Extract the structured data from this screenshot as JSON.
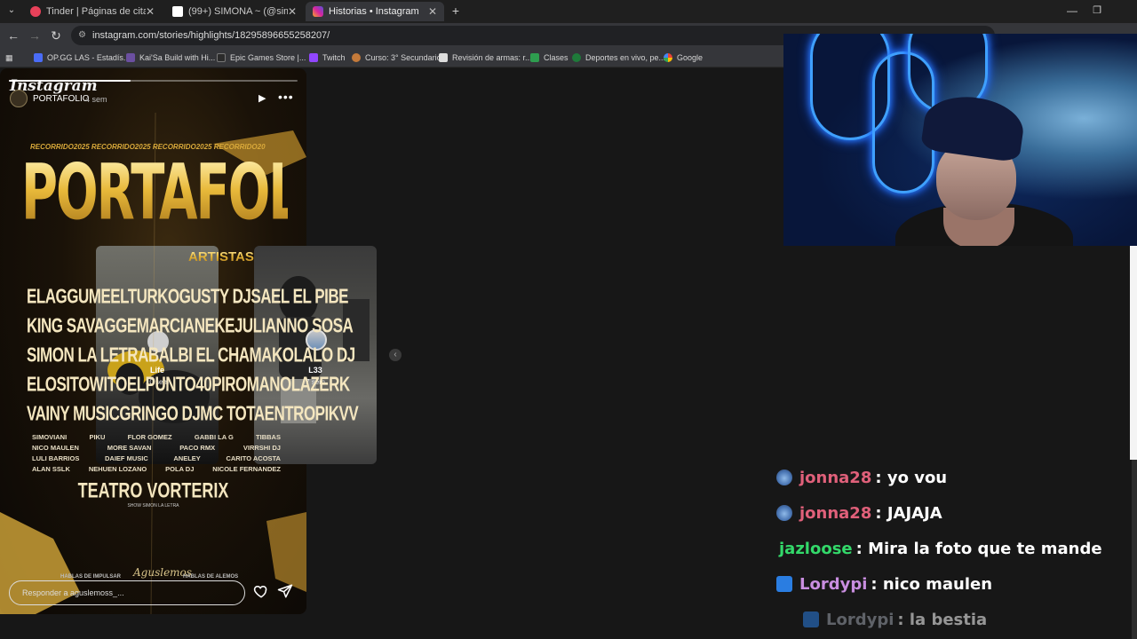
{
  "browser": {
    "tabs": [
      {
        "label": "Tinder | Páginas de citas",
        "icon_color": "#e8415a",
        "active": false
      },
      {
        "label": "(99+) SIMONA ~ (@simovianii)",
        "icon_color": "#ffffff",
        "active": false
      },
      {
        "label": "Historias • Instagram",
        "icon_color": "#d6249f",
        "active": true
      }
    ],
    "new_tab_label": "+",
    "url": "instagram.com/stories/highlights/18295896655258207/",
    "bookmarks": [
      {
        "label": "OP.GG LAS - Estadís...",
        "icon_color": "#4a6cf7"
      },
      {
        "label": "Kai'Sa Build with Hi...",
        "icon_color": "#6b4fa0"
      },
      {
        "label": "Epic Games Store |...",
        "icon_color": "#2b2b2b"
      },
      {
        "label": "Twitch",
        "icon_color": "#9146ff"
      },
      {
        "label": "Curso: 3° Secundario",
        "icon_color": "#c47a3a"
      },
      {
        "label": "Revisión de armas: r...",
        "icon_color": "#dddddd"
      },
      {
        "label": "Clases",
        "icon_color": "#2e9d4f"
      },
      {
        "label": "Deportes en vivo, pe...",
        "icon_color": "#1f7a3a"
      },
      {
        "label": "Google",
        "icon_color": "#ffffff"
      }
    ]
  },
  "instagram": {
    "logo": "Instagram",
    "previews": [
      {
        "title": "Life",
        "time": "10 sem"
      },
      {
        "title": "L33",
        "time": "7 sem"
      }
    ],
    "story": {
      "progress": 0.42,
      "username": "PORTAFOLIO",
      "time": "4 sem",
      "reply_placeholder": "Responder a aguslemoss_...",
      "poster": {
        "recorrido_line": "RECORRIDO2025 RECORRIDO2025 RECORRIDO2025 RECORRIDO20",
        "title": "PORTAFOLIO",
        "subtitle": "ARTISTAS",
        "artist_rows": [
          [
            "ELAGGUME",
            "ELTURKO",
            "GUSTY DJ",
            "SAEL EL PIBE"
          ],
          [
            "KING SAVAGGE",
            "MARCIANEKE",
            "JULIANNO SOSA"
          ],
          [
            "SIMON LA LETRA",
            "BALBI EL CHAMAKO",
            "LALO DJ"
          ],
          [
            "ELOSITOWITO",
            "ELPUNTO40",
            "PIROMANO",
            "LAZERK"
          ],
          [
            "VAINY MUSIC",
            "GRINGO DJ",
            "MC TOTA",
            "ENTROPIKVV"
          ]
        ],
        "small_rows": [
          [
            "SIMOVIANI",
            "PIKU",
            "FLOR GOMEZ",
            "GABBI LA G",
            "TIBBAS"
          ],
          [
            "NICO MAULEN",
            "MORE SAVAN",
            "PACO RMX",
            "VIRRSHI DJ"
          ],
          [
            "LULI BARRIOS",
            "DAIEF MUSIC",
            "ANELEY",
            "CARITO ACOSTA"
          ],
          [
            "ALAN SSLK",
            "NEHUEN LOZANO",
            "POLA DJ",
            "NICOLE FERNANDEZ"
          ]
        ],
        "venue": "TEATRO VORTERIX",
        "venue_sub": "SHOW SIMON LA LETRA",
        "footer_left": "HABLAS DE IMPULSAR",
        "footer_mid": "Aguslemos",
        "footer_right": "HABLAS DE ALEMOS"
      }
    }
  },
  "chat": {
    "messages": [
      {
        "user": "jonna28",
        "user_color": "#e0607a",
        "text": ": yo vou",
        "badge": "stitch"
      },
      {
        "user": "jonna28",
        "user_color": "#e0607a",
        "text": ": JAJAJA",
        "badge": "stitch"
      },
      {
        "user": "jazloose",
        "user_color": "#33d96a",
        "text": ": Mira la foto que te mande",
        "badge": ""
      },
      {
        "user": "Lordypi",
        "user_color": "#c98ee0",
        "text": ": nico maulen",
        "badge": "prime"
      },
      {
        "user": "Lordypi",
        "user_color": "#9aa0ab",
        "text": ": la bestia",
        "badge": "prime"
      }
    ]
  }
}
